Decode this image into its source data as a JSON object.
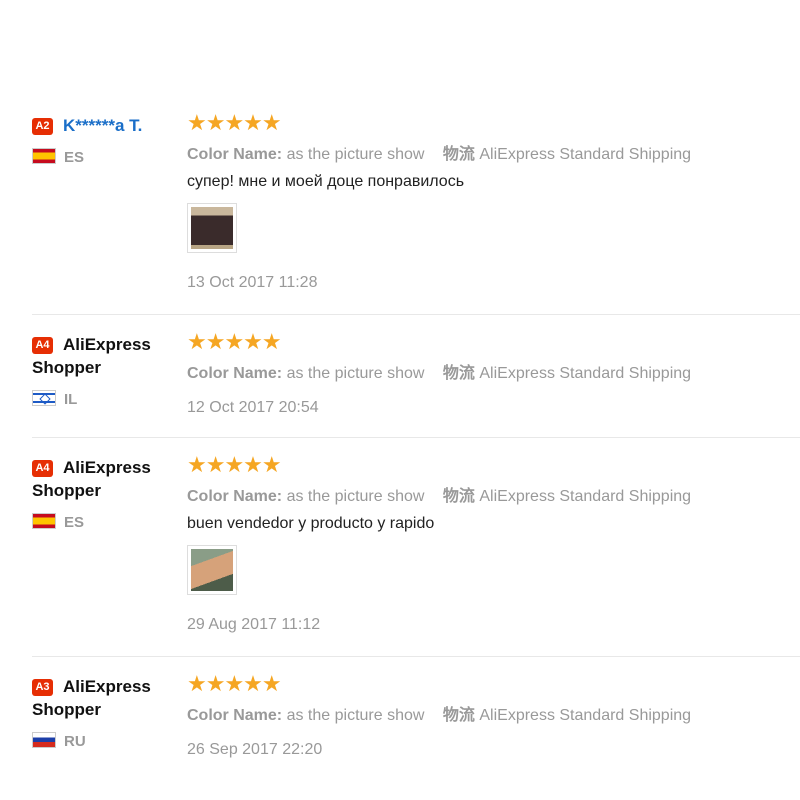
{
  "reviews": [
    {
      "level": "A2",
      "user": "K******a T.",
      "country": "ES",
      "flag": "es",
      "stars": "★★★★★",
      "color_label": "Color Name:",
      "color_value": "as the picture show",
      "shipping_label": "物流",
      "shipping_value": "AliExpress Standard Shipping",
      "comment": "супер! мне и моей доце понравилось",
      "photo": "backpack-photo",
      "date": "13 Oct 2017 11:28"
    },
    {
      "level": "A4",
      "user": "AliExpress Shopper",
      "country": "IL",
      "flag": "il",
      "stars": "★★★★★",
      "color_label": "Color Name:",
      "color_value": "as the picture show",
      "shipping_label": "物流",
      "shipping_value": "AliExpress Standard Shipping",
      "comment": "",
      "photo": "",
      "date": "12 Oct 2017 20:54"
    },
    {
      "level": "A4",
      "user": "AliExpress Shopper",
      "country": "ES",
      "flag": "es",
      "stars": "★★★★★",
      "color_label": "Color Name:",
      "color_value": "as the picture show",
      "shipping_label": "物流",
      "shipping_value": "AliExpress Standard Shipping",
      "comment": "buen vendedor y producto y rapido",
      "photo": "thumbs-up-photo",
      "date": "29 Aug 2017 11:12"
    },
    {
      "level": "A3",
      "user": "AliExpress Shopper",
      "country": "RU",
      "flag": "ru",
      "stars": "★★★★★",
      "color_label": "Color Name:",
      "color_value": "as the picture show",
      "shipping_label": "物流",
      "shipping_value": "AliExpress Standard Shipping",
      "comment": "",
      "photo": "",
      "date": "26 Sep 2017 22:20"
    }
  ]
}
